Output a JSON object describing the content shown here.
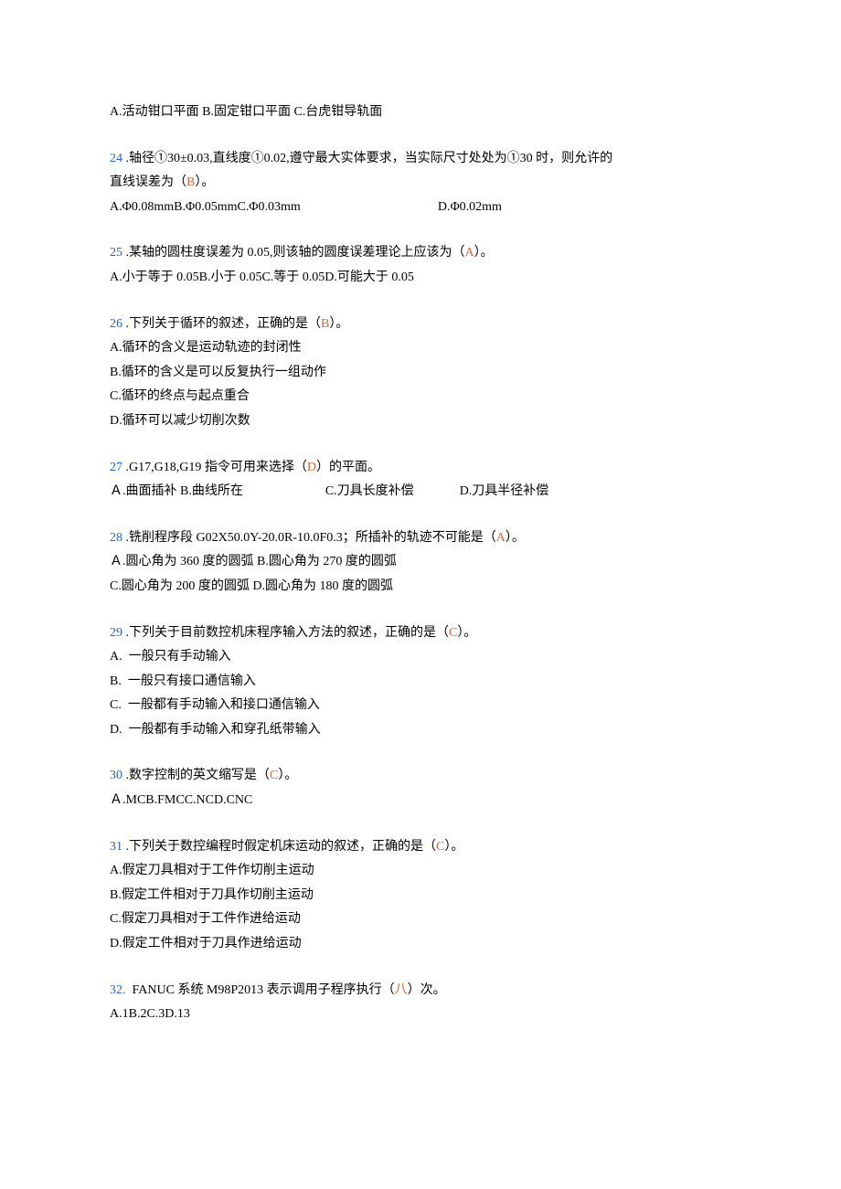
{
  "q23": {
    "options": "A.活动钳口平面 B.固定钳口平面 C.台虎钳导轨面"
  },
  "q24": {
    "num": "24",
    "text1": " .轴径①30±0.03,直线度①0.02,遵守最大实体要求，当实际尺寸处处为①30 时，则允许的",
    "text2": "直线误差为（",
    "ans": "B",
    "text3": "）。",
    "optsA": "A.Φ0.08mmB.Φ0.05mmC.Φ0.03mm",
    "optsB": "D.Φ0.02mm"
  },
  "q25": {
    "num": "25",
    "text1": " .某轴的圆柱度误差为 0.05,则该轴的圆度误差理论上应该为（",
    "ans": "A",
    "text2": "）。",
    "opts": "A.小于等于 0.05B.小于 0.05C.等于 0.05D.可能大于 0.05"
  },
  "q26": {
    "num": "26",
    "text1": " .下列关于循环的叙述，正确的是（",
    "ans": "B",
    "text2": "）。",
    "a": "A.循环的含义是运动轨迹的封闭性",
    "b": "B.循环的含义是可以反复执行一组动作",
    "c": "C.循环的终点与起点重合",
    "d": "D.循环可以减少切削次数"
  },
  "q27": {
    "num": "27",
    "text1": " .G17,G18,G19 指令可用来选择（",
    "ans": "D",
    "text2": "）的平面。",
    "optA": "Ａ.曲面插补 B.曲线所在",
    "optC": "C.刀具长度补偿",
    "optD": "D.刀具半径补偿"
  },
  "q28": {
    "num": "28",
    "text1": " .铣削程序段 G02X50.0Y-20.0R-10.0F0.3；所插补的轨迹不可能是（",
    "ans": "A",
    "text2": "）。",
    "optAB": "Ａ.圆心角为 360 度的圆弧 B.圆心角为 270 度的圆弧",
    "optCD": "C.圆心角为 200 度的圆弧 D.圆心角为 180 度的圆弧"
  },
  "q29": {
    "num": "29",
    "text1": " .下列关于目前数控机床程序输入方法的叙述，正确的是（",
    "ans": "C",
    "text2": "）。",
    "a": "A.  一般只有手动输入",
    "b": "B.  一般只有接口通信输入",
    "c": "C.  一般都有手动输入和接口通信输入",
    "d": "D.  一般都有手动输入和穿孔纸带输入"
  },
  "q30": {
    "num": "30",
    "text1": " .数字控制的英文缩写是（",
    "ans": "C",
    "text2": "）。",
    "opts": "Ａ.MCB.FMCC.NCD.CNC"
  },
  "q31": {
    "num": "31",
    "text1": " .下列关于数控编程时假定机床运动的叙述，正确的是（",
    "ans": "C",
    "text2": "）。",
    "a": "A.假定刀具相对于工件作切削主运动",
    "b": "B.假定工件相对于刀具作切削主运动",
    "c": "C.假定刀具相对于工件作进给运动",
    "d": "D.假定工件相对于刀具作进给运动"
  },
  "q32": {
    "num": "32.",
    "text1": "  FANUC 系统 M98P2013 表示调用子程序执行（",
    "ans": "八",
    "text2": "）次。",
    "opts": "A.1B.2C.3D.13"
  }
}
